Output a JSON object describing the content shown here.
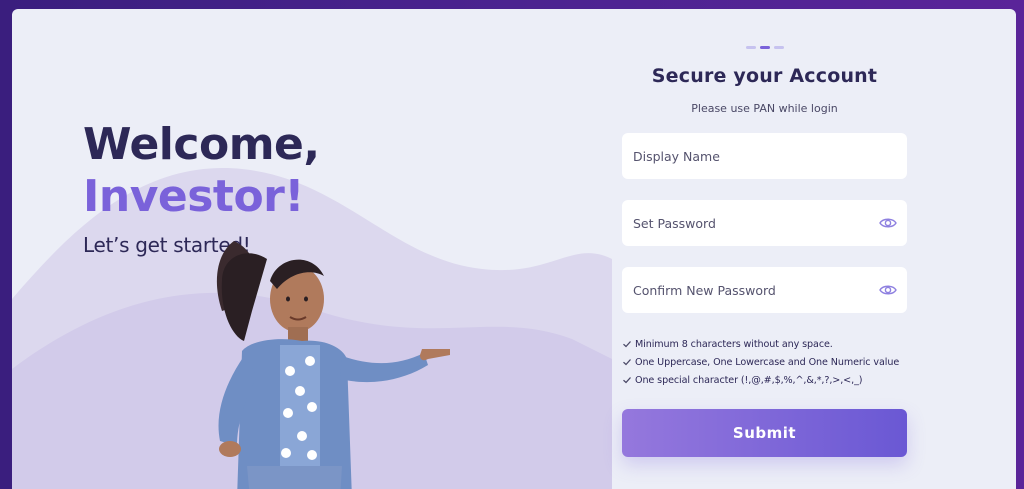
{
  "welcome": {
    "line1": "Welcome,",
    "line2": "Investor!",
    "tagline": "Let’s get started!"
  },
  "form": {
    "step_total": 3,
    "step_active": 2,
    "title": "Secure your Account",
    "subtitle": "Please use PAN while login",
    "display_name_placeholder": "Display Name",
    "password_placeholder": "Set Password",
    "confirm_password_placeholder": "Confirm New Password",
    "rules": [
      "Minimum 8 characters without any space.",
      "One Uppercase, One Lowercase and One Numeric value",
      "One special character  (!,@,#,$,%,^,&,*,?,>,<,_)"
    ],
    "submit_label": "Submit"
  },
  "icons": {
    "password_toggle": "eye-icon",
    "rule_marker": "check-icon",
    "illustration": "woman-pointing-illustration"
  },
  "colors": {
    "background": "#4b2390",
    "card": "#eceef7",
    "heading": "#2d2857",
    "accent": "#7a62da",
    "button_start": "#9578dd",
    "button_end": "#6a58d4"
  }
}
